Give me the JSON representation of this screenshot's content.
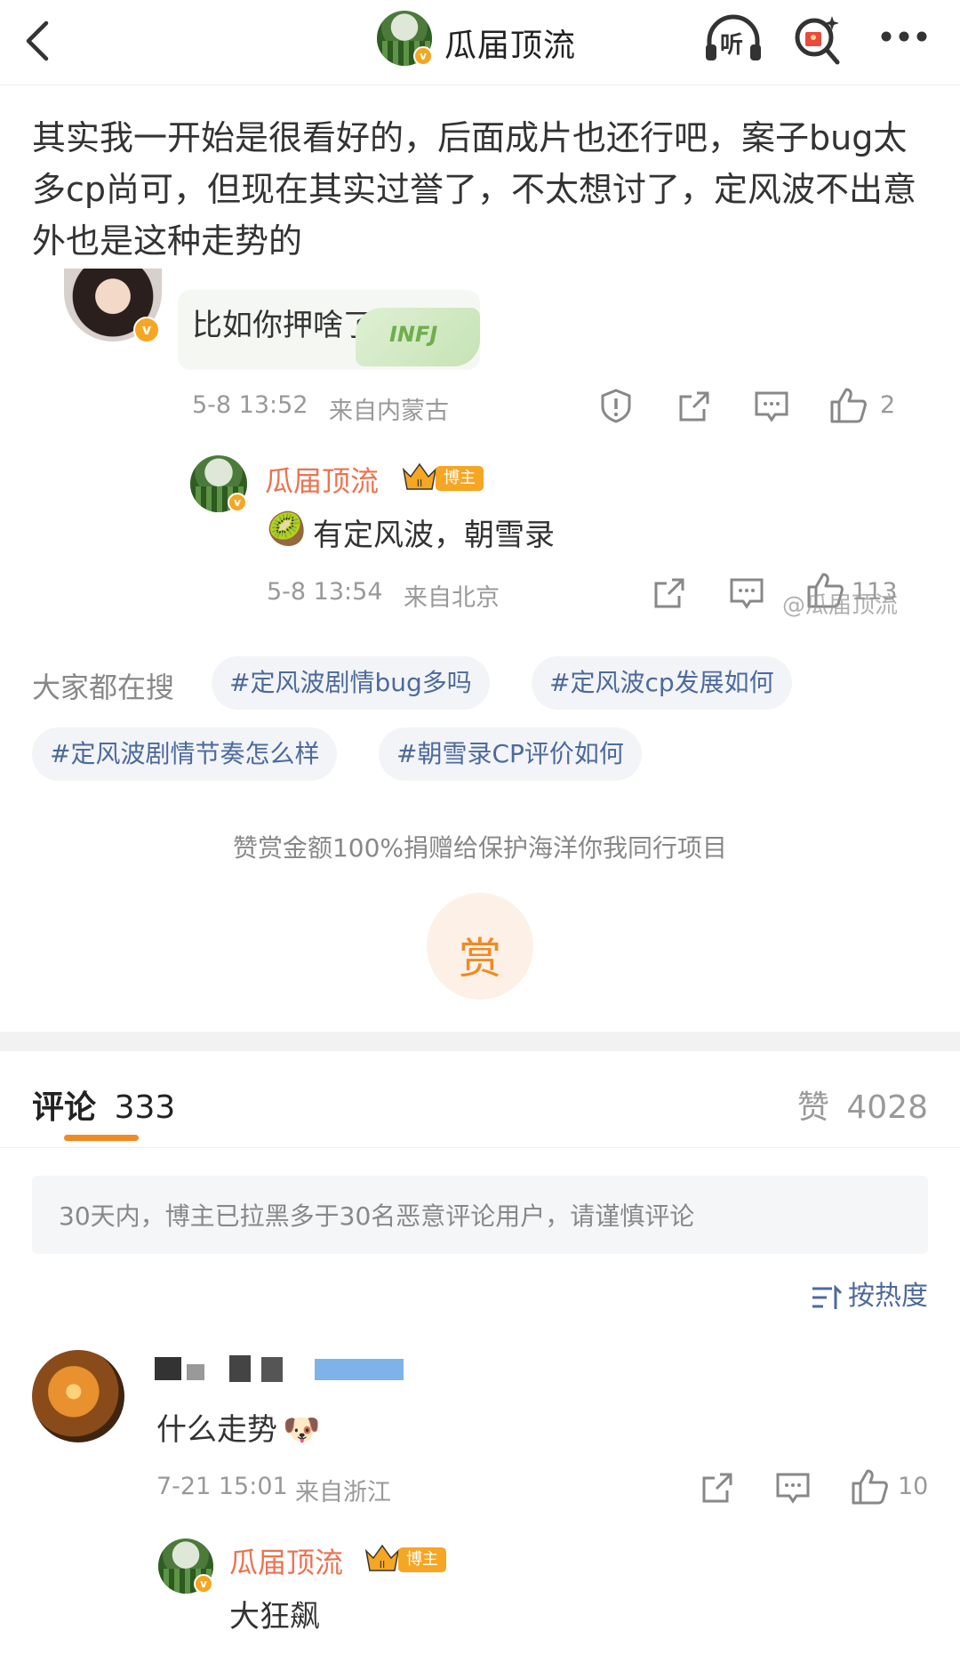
{
  "nav": {
    "title": "瓜届顶流",
    "listen_label": "听",
    "icons": [
      "back-icon",
      "headphones-icon",
      "search-redpacket-icon",
      "more-icon"
    ]
  },
  "post": {
    "text": "其实我一开始是很看好的，后面成片也还行吧，案子bug太多cp尚可，但现在其实过誉了，不太想讨了，定风波不出意外也是这种走势的"
  },
  "reply1": {
    "text": "比如你押啥了",
    "sticker_label": "INFJ",
    "time": "5-8 13:52",
    "location": "来自内蒙古",
    "likes": "2"
  },
  "reply1_author_reply": {
    "username": "瓜届顶流",
    "badge": "博主",
    "text": "有定风波，朝雪录",
    "emoji": "🥝",
    "time": "5-8 13:54",
    "location": "来自北京",
    "likes": "113",
    "watermark": "@瓜届顶流"
  },
  "search_block": {
    "label": "大家都在搜",
    "tags": [
      "#定风波剧情bug多吗",
      "#定风波cp发展如何",
      "#定风波剧情节奏怎么样",
      "#朝雪录CP评价如何"
    ]
  },
  "reward": {
    "notice": "赞赏金额100%捐赠给保护海洋你我同行项目",
    "button": "赏"
  },
  "comments_header": {
    "comments_label": "评论",
    "comments_count": "333",
    "likes_label": "赞",
    "likes_count": "4028"
  },
  "blacklist_notice": "30天内，博主已拉黑多于30名恶意评论用户，请谨慎评论",
  "sort_label": "按热度",
  "comment1": {
    "text": "什么走势",
    "emoji": "🐶",
    "time": "7-21 15:01",
    "location": "来自浙江",
    "likes": "10"
  },
  "comment1_author_reply": {
    "username": "瓜届顶流",
    "badge": "博主",
    "text": "大狂飙"
  },
  "colors": {
    "accent_orange": "#eb7350",
    "link_blue": "#4d6a9c",
    "tab_underline": "#f08a24",
    "vip_gold": "#f5a623"
  }
}
